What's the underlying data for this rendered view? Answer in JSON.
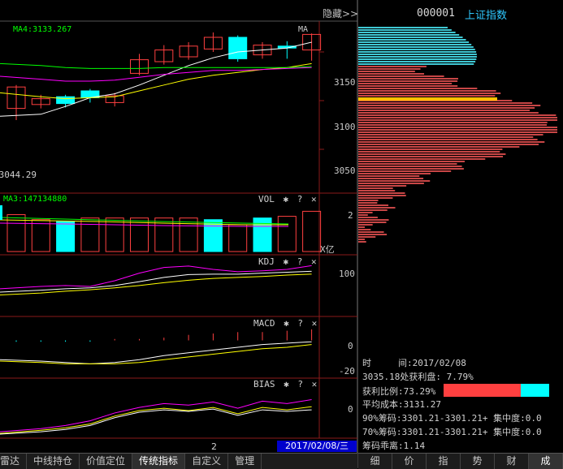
{
  "header": {
    "hide_label": "隐藏>>",
    "stock_code": "000001",
    "stock_name": "上证指数"
  },
  "main_panel": {
    "ma4_label": "MA4:3133.267",
    "ma_button": "MA",
    "low_price_label": "←3044.29",
    "y_ticks": [
      "3150",
      "3100",
      "3050"
    ]
  },
  "vol_panel": {
    "ma3_label": "MA3:147134880",
    "name": "VOL",
    "y_tick": "2",
    "unit": "X亿"
  },
  "kdj_panel": {
    "name": "KDJ",
    "y_tick": "100"
  },
  "macd_panel": {
    "name": "MACD",
    "y_ticks": [
      "0",
      "-20"
    ]
  },
  "bias_panel": {
    "name": "BIAS",
    "y_tick": "0"
  },
  "controls": {
    "gear": "✱",
    "help": "?",
    "close": "✕"
  },
  "date_bar": {
    "page": "2",
    "date": "2017/02/08/三"
  },
  "bottom_tabs": [
    "雷达",
    "中线持仓",
    "价值定位",
    "传统指标",
    "自定义",
    "管理"
  ],
  "bottom_active": "传统指标",
  "right_tabs": [
    "细",
    "价",
    "指",
    "势",
    "财",
    "成"
  ],
  "right_active": "成",
  "chip_info": {
    "time_label": "时　　　间:2017/02/08",
    "profit_at": "3035.18处获利盘: 7.79%",
    "profit_ratio": "获利比例:73.29%",
    "avg_cost": "平均成本:3131.27",
    "chip90": "90%筹码:3301.21-3301.21+ 集中度:0.0",
    "chip70": "70%筹码:3301.21-3301.21+ 集中度:0.0",
    "deviation": "筹码乖离:1.14",
    "profit_fraction": 0.7329
  },
  "colors": {
    "up": "#ff4040",
    "down": "#00ffff",
    "ma_white": "#ffffff",
    "ma_yellow": "#ffff00",
    "ma_magenta": "#ff00ff",
    "ma_green": "#00ff00",
    "chip_red": "#c84646",
    "chip_cyan": "#3fc8d4",
    "avg_line": "#ffc000",
    "date_bg": "#0000cc"
  },
  "chart_data": [
    {
      "type": "candlestick",
      "title": "上证指数",
      "ylim": [
        3010,
        3175
      ],
      "candles": [
        {
          "o": 3092,
          "c": 3114,
          "h": 3116,
          "l": 3080,
          "dir": "up"
        },
        {
          "o": 3102,
          "c": 3096,
          "h": 3106,
          "l": 3092,
          "dir": "up"
        },
        {
          "o": 3097,
          "c": 3104,
          "h": 3106,
          "l": 3093,
          "dir": "down"
        },
        {
          "o": 3103,
          "c": 3110,
          "h": 3112,
          "l": 3098,
          "dir": "down"
        },
        {
          "o": 3105,
          "c": 3098,
          "h": 3108,
          "l": 3094,
          "dir": "up"
        },
        {
          "o": 3128,
          "c": 3142,
          "h": 3148,
          "l": 3126,
          "dir": "up"
        },
        {
          "o": 3140,
          "c": 3152,
          "h": 3157,
          "l": 3137,
          "dir": "up"
        },
        {
          "o": 3145,
          "c": 3156,
          "h": 3160,
          "l": 3142,
          "dir": "up"
        },
        {
          "o": 3153,
          "c": 3165,
          "h": 3170,
          "l": 3150,
          "dir": "up"
        },
        {
          "o": 3165,
          "c": 3143,
          "h": 3167,
          "l": 3140,
          "dir": "down"
        },
        {
          "o": 3147,
          "c": 3157,
          "h": 3160,
          "l": 3143,
          "dir": "up"
        },
        {
          "o": 3156,
          "c": 3154,
          "h": 3161,
          "l": 3143,
          "dir": "down"
        },
        {
          "o": 3152,
          "c": 3168,
          "h": 3169,
          "l": 3141,
          "dir": "up"
        }
      ],
      "series": [
        {
          "color": "#ffffff",
          "values": [
            3084,
            3086,
            3094,
            3103,
            3107,
            3116,
            3126,
            3136,
            3144,
            3150,
            3152,
            3154,
            3160
          ]
        },
        {
          "color": "#ffff00",
          "values": [
            3108,
            3104,
            3102,
            3103,
            3104,
            3110,
            3116,
            3122,
            3126,
            3129,
            3132,
            3134,
            3138
          ]
        },
        {
          "color": "#ff00ff",
          "values": [
            3125,
            3122,
            3120,
            3120,
            3121,
            3124,
            3127,
            3129,
            3131,
            3131,
            3132,
            3133,
            3134
          ]
        },
        {
          "color": "#00ff00",
          "values": [
            3138,
            3136,
            3134,
            3133,
            3133,
            3133,
            3134,
            3134,
            3134,
            3134,
            3134,
            3134,
            3135
          ]
        }
      ]
    },
    {
      "type": "bar",
      "title": "VOL",
      "ylim": [
        0,
        3
      ],
      "values": [
        2.2,
        1.9,
        1.8,
        2.0,
        2.0,
        2.0,
        2.0,
        2.0,
        1.9,
        1.6,
        2.0,
        2.1,
        2.4
      ],
      "dir": [
        "up",
        "up",
        "down",
        "up",
        "up",
        "up",
        "up",
        "up",
        "down",
        "up",
        "down",
        "up",
        "up"
      ]
    },
    {
      "type": "line",
      "title": "KDJ",
      "ylim": [
        0,
        120
      ],
      "series": [
        {
          "color": "#ff00ff",
          "values": [
            55,
            60,
            62,
            60,
            72,
            88,
            100,
            103,
            96,
            91,
            93,
            96,
            104
          ]
        },
        {
          "color": "#ffffff",
          "values": [
            48,
            52,
            55,
            57,
            62,
            70,
            79,
            85,
            86,
            86,
            88,
            90,
            92
          ]
        },
        {
          "color": "#ffff00",
          "values": [
            42,
            46,
            50,
            53,
            57,
            62,
            68,
            73,
            77,
            79,
            81,
            84,
            86
          ]
        }
      ]
    },
    {
      "type": "bar",
      "title": "MACD",
      "ylim": [
        -25,
        15
      ],
      "values": [
        -1,
        -1,
        -1,
        -1,
        1,
        1,
        2,
        4,
        5,
        6,
        6,
        7,
        8
      ],
      "series": [
        {
          "color": "#ffffff",
          "values": [
            -14,
            -15,
            -16,
            -17,
            -16,
            -14,
            -11,
            -9,
            -7,
            -5,
            -3,
            -2,
            -1
          ]
        },
        {
          "color": "#ffff00",
          "values": [
            -15,
            -16,
            -17,
            -17,
            -17,
            -16,
            -14,
            -12,
            -10,
            -8,
            -6,
            -5,
            -3
          ]
        }
      ]
    },
    {
      "type": "line",
      "title": "BIAS",
      "ylim": [
        -3,
        3
      ],
      "series": [
        {
          "color": "#ff00ff",
          "values": [
            -2.6,
            -2.2,
            -1.8,
            -1.2,
            -0.2,
            0.5,
            1.0,
            0.8,
            1.2,
            0.4,
            1.3,
            1.0,
            1.5
          ]
        },
        {
          "color": "#ffff00",
          "values": [
            -2.8,
            -2.4,
            -2.1,
            -1.6,
            -0.6,
            0.1,
            0.4,
            0.1,
            0.5,
            -0.3,
            0.5,
            0.2,
            0.6
          ]
        },
        {
          "color": "#ffffff",
          "values": [
            -2.9,
            -2.6,
            -2.3,
            -1.8,
            -0.8,
            -0.1,
            0.2,
            0.0,
            0.3,
            -0.5,
            0.2,
            0.0,
            0.2
          ]
        }
      ]
    },
    {
      "type": "bar",
      "title": "筹码分布",
      "ylim": [
        3010,
        3175
      ],
      "avg_cost": 3131.27,
      "profit_fraction": 0.7329
    }
  ]
}
